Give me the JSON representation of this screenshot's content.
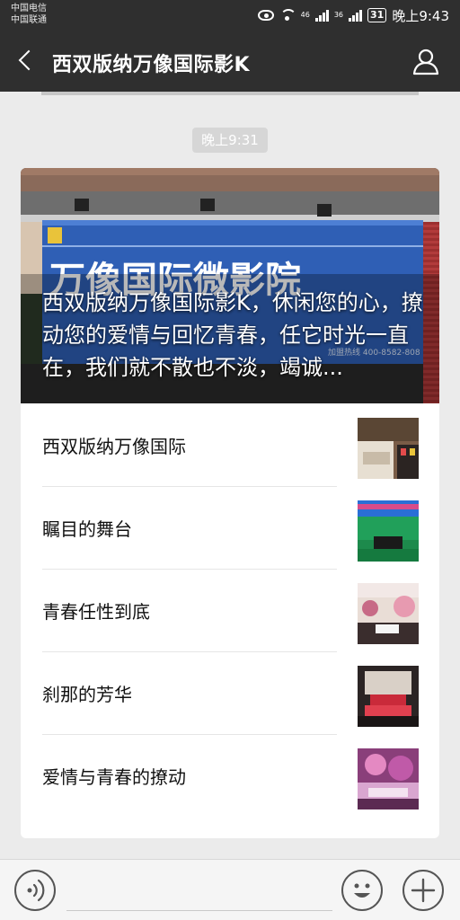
{
  "status": {
    "carrier1": "中国电信",
    "carrier2": "中国联通",
    "net1": "46",
    "net2": "36",
    "battery": "31",
    "time": "晚上9:43"
  },
  "nav": {
    "title": "西双版纳万像国际影K",
    "back_icon": "chevron-left-icon",
    "profile_icon": "person-icon"
  },
  "chat": {
    "timestamp": "晚上9:31"
  },
  "article": {
    "cover_summary": "西双版纳万像国际影K，休闲您的心，撩动您的爱情与回忆青春，任它时光一直在，我们就不散也不淡，竭诚...",
    "sign_text": "万像国际微影院",
    "sign_phone": "加盟热线 400-8582-808",
    "items": [
      {
        "label": "西双版纳万像国际"
      },
      {
        "label": "瞩目的舞台"
      },
      {
        "label": "青春任性到底"
      },
      {
        "label": "刹那的芳华"
      },
      {
        "label": "爱情与青春的撩动"
      }
    ]
  },
  "colors": {
    "header_bg": "#2f2f2f",
    "sign_blue": "#2f5fb5",
    "background": "#ebebeb"
  }
}
